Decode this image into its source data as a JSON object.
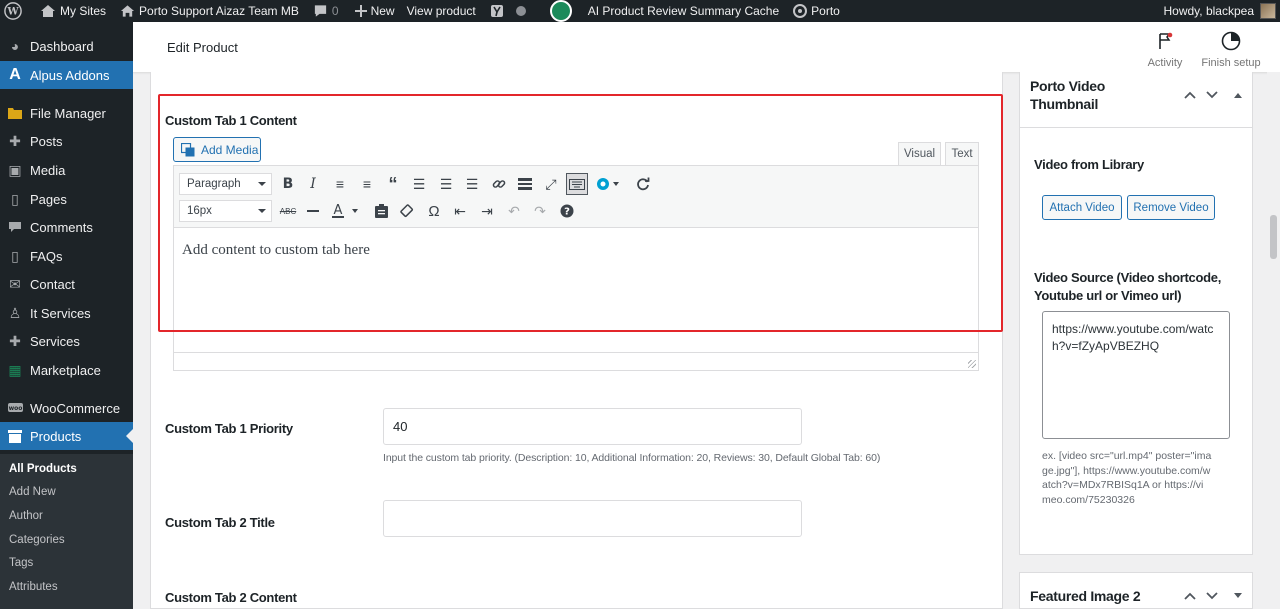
{
  "adminbar": {
    "my_sites": "My Sites",
    "site_name": "Porto Support Aizaz Team MB",
    "comments_count": "0",
    "new_label": "New",
    "view_product": "View product",
    "cache_label": "AI Product Review Summary Cache",
    "porto_label": "Porto",
    "howdy": "Howdy, blackpea"
  },
  "sidebar": {
    "dashboard": "Dashboard",
    "alpus_addons": "Alpus Addons",
    "file_manager": "File Manager",
    "posts": "Posts",
    "media": "Media",
    "pages": "Pages",
    "comments": "Comments",
    "faqs": "FAQs",
    "contact": "Contact",
    "it_services": "It Services",
    "services": "Services",
    "marketplace": "Marketplace",
    "woocommerce": "WooCommerce",
    "products": "Products",
    "submenu": {
      "all_products": "All Products",
      "add_new": "Add New",
      "author": "Author",
      "categories": "Categories",
      "tags": "Tags",
      "attributes": "Attributes"
    }
  },
  "header": {
    "title": "Edit Product",
    "activity": "Activity",
    "finish_setup": "Finish setup"
  },
  "main": {
    "tab1_content_label": "Custom Tab 1 Content",
    "add_media": "Add Media",
    "visual_tab": "Visual",
    "text_tab": "Text",
    "format_select": "Paragraph",
    "fontsize_select": "16px",
    "editor_placeholder": "Add content to custom tab here",
    "tab1_priority_label": "Custom Tab 1 Priority",
    "tab1_priority_value": "40",
    "tab1_priority_help": "Input the custom tab priority. (Description: 10, Additional Information: 20, Reviews: 30, Default Global Tab: 60)",
    "tab2_title_label": "Custom Tab 2 Title",
    "tab2_title_value": "",
    "tab2_content_label": "Custom Tab 2 Content"
  },
  "video_box": {
    "title": "Porto Video Thumbnail",
    "video_library_label": "Video from Library",
    "attach_video": "Attach Video",
    "remove_video": "Remove Video",
    "video_source_label": "Video Source (Video shortcode, Youtube url or Vimeo url)",
    "video_source_value": "https://www.youtube.com/watch?v=fZyApVBEZHQ",
    "help": "ex. [video src=\"url.mp4\" poster=\"image.jpg\"], https://www.youtube.com/watch?v=MDx7RBISq1A or https://vimeo.com/75230326"
  },
  "featured_box": {
    "title": "Featured Image 2"
  },
  "colors": {
    "admin_dark": "#1d2327",
    "accent_blue": "#2271b1",
    "highlight_red": "#e3262b"
  }
}
